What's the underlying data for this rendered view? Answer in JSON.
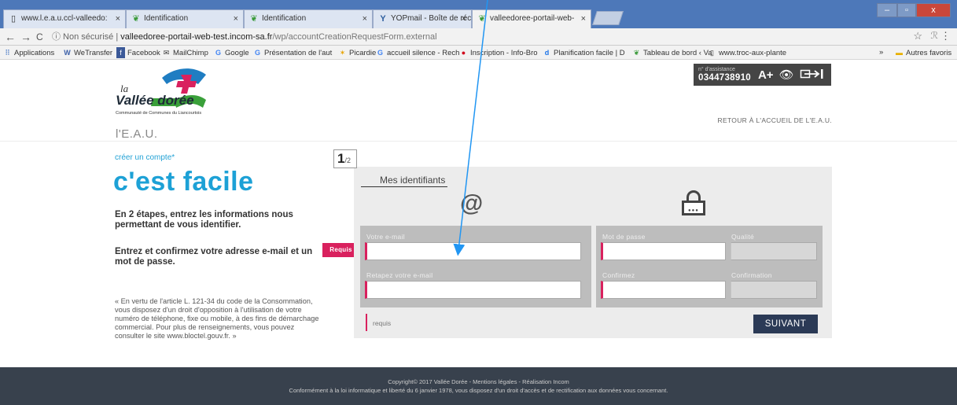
{
  "browser": {
    "tabs": [
      {
        "title": "www.l.e.a.u.ccl-valleedo:",
        "icon": "page-icon"
      },
      {
        "title": "Identification",
        "icon": "plant-icon"
      },
      {
        "title": "Identification",
        "icon": "plant-icon"
      },
      {
        "title": "YOPmail - Boîte de récep",
        "icon": "yopmail-icon"
      },
      {
        "title": "valleedoree-portail-web-",
        "icon": "plant-icon"
      }
    ],
    "close_glyph": "×",
    "window_buttons": {
      "minimize": "–",
      "maximize": "▫",
      "close": "x"
    },
    "nav": {
      "back": "←",
      "forward": "→",
      "reload": "C"
    },
    "address": {
      "security": "ⓘ Non sécurisé",
      "separator": "|",
      "domain": "valleedoree-portail-web-test.incom-sa.fr",
      "path": "/wp/accountCreationRequestForm.external"
    },
    "bookmarks": [
      {
        "label": "Applications",
        "icon": "apps-icon"
      },
      {
        "label": "WeTransfer",
        "icon": "wetransfer-icon"
      },
      {
        "label": "Facebook",
        "icon": "facebook-icon"
      },
      {
        "label": "MailChimp",
        "icon": "mailchimp-icon"
      },
      {
        "label": "Google",
        "icon": "google-icon"
      },
      {
        "label": "Présentation de l'aut",
        "icon": "google-icon"
      },
      {
        "label": "Picardie",
        "icon": "star-icon"
      },
      {
        "label": "accueil silence - Rech",
        "icon": "google-icon"
      },
      {
        "label": "Inscription - Info-Bro",
        "icon": "alert-icon"
      },
      {
        "label": "Planification facile | D",
        "icon": "doodle-icon"
      },
      {
        "label": "Tableau de bord ‹ Va",
        "icon": "plant-icon"
      },
      {
        "label": "www.troc-aux-plante",
        "icon": "page-icon"
      },
      {
        "label": "»",
        "icon": ""
      },
      {
        "label": "Autres favoris",
        "icon": "folder-icon"
      }
    ]
  },
  "header": {
    "logo": {
      "la": "la",
      "name": "Vallée dorée",
      "sub": "Communauté de Communes du Liancourtois"
    },
    "site_name": "l'E.A.U.",
    "assistance": {
      "label": "n° d'assistance",
      "number": "0344738910",
      "font_size_label": "A+",
      "eye": "👁",
      "exit": "⇥"
    },
    "back_link": "RETOUR À L'ACCUEIL DE L'E.A.U."
  },
  "intro": {
    "kicker": "créer un compte*",
    "headline": "c'est facile",
    "paragraph1": "En 2 étapes, entrez les informations nous permettant de vous identifier.",
    "paragraph2": "Entrez et confirmez votre adresse e-mail et un mot de passe.",
    "requis_tag": "Requis",
    "legal": "« En vertu de l'article L. 121-34 du code de la Consommation, vous disposez d'un droit d'opposition à l'utilisation de votre numéro de téléphone, fixe ou mobile, à des fins de démarchage commercial. Pour plus de renseignements, vous pouvez consulter le site www.bloctel.gouv.fr. »"
  },
  "form": {
    "step": {
      "current": "1",
      "total": "/2"
    },
    "tab_label": "Mes identifiants",
    "email_icon": "@",
    "fields": {
      "email_label": "Votre e-mail",
      "email_value": "",
      "email_confirm_label": "Retapez votre e-mail",
      "email_confirm_value": "",
      "password_label": "Mot de passe",
      "password_confirm_label": "Confirmez",
      "quality_label": "Qualité",
      "confirmation_label": "Confirmation"
    },
    "required_legend": "requis",
    "next_button": "SUIVANT"
  },
  "footer": {
    "line1": "Copyright© 2017 Vallée Dorée  -  Mentions légales  -  Réalisation Incom",
    "line2": "Conformément à la loi informatique et liberté du 6 janvier 1978, vous disposez d'un droit d'accès et de rectification aux données vous concernant."
  },
  "colors": {
    "accent_blue": "#1da1d6",
    "required_pink": "#d9215e",
    "button_navy": "#2b3a56",
    "footer_bg": "#38414d",
    "annotation_arrow": "#2196f3"
  }
}
